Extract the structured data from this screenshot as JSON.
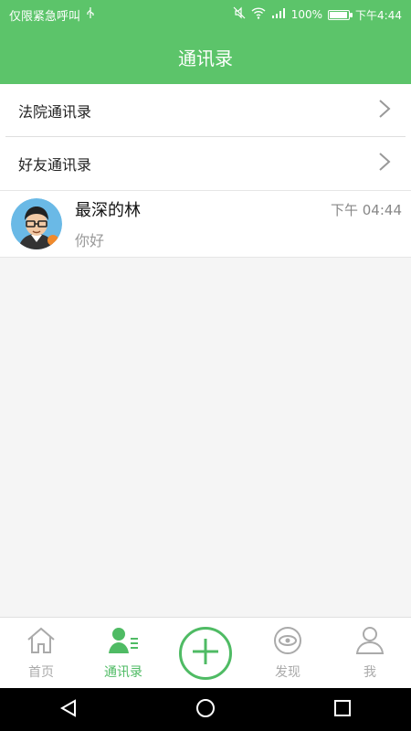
{
  "status_bar": {
    "carrier_text": "仅限紧急呼叫",
    "usb_icon": "usb-icon",
    "battery_text": "100%",
    "time": "下午4:44",
    "battery_level": 1.0
  },
  "header": {
    "title": "通讯录"
  },
  "menu": {
    "items": [
      {
        "label": "法院通讯录"
      },
      {
        "label": "好友通讯录"
      }
    ]
  },
  "chat": {
    "name": "最深的林",
    "preview": "你好",
    "time": "下午 04:44"
  },
  "tabs": [
    {
      "label": "首页",
      "icon": "home-icon",
      "active": false
    },
    {
      "label": "通讯录",
      "icon": "contacts-icon",
      "active": true
    },
    {
      "label": "",
      "icon": "add-icon",
      "active": false
    },
    {
      "label": "发现",
      "icon": "eye-icon",
      "active": false
    },
    {
      "label": "我",
      "icon": "person-icon",
      "active": false
    }
  ],
  "colors": {
    "accent": "#5cc46a",
    "tab_active": "#4fbb64",
    "tab_inactive": "#aaaaaa"
  }
}
